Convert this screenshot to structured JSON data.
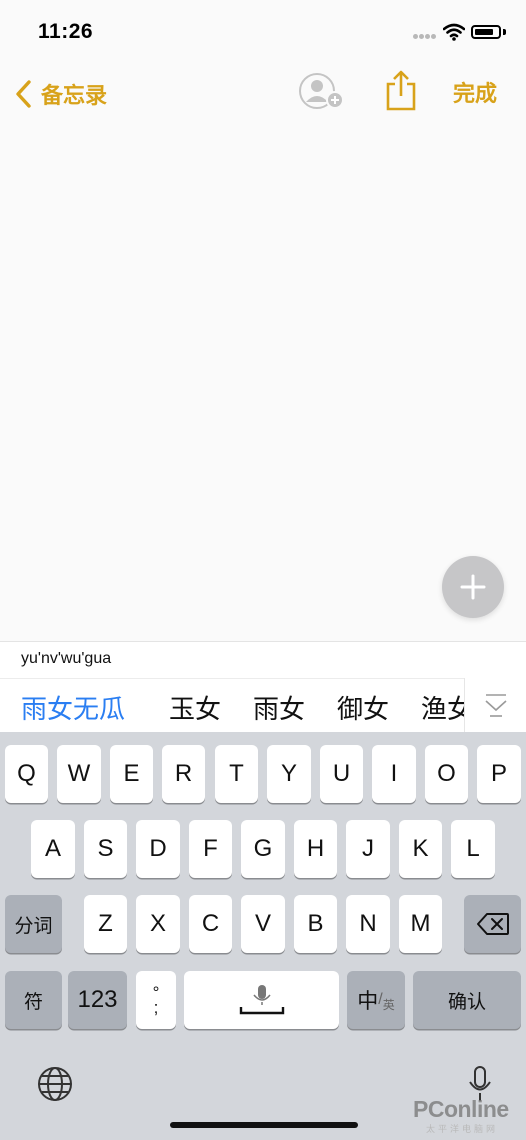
{
  "status_bar": {
    "time": "11:26"
  },
  "nav": {
    "back_label": "备忘录",
    "done_label": "完成"
  },
  "icons": {
    "back": "chevron-left-icon",
    "add_people": "person-add-icon",
    "share": "share-icon",
    "new_item": "plus-icon",
    "expand": "chevron-down-icon",
    "backspace": "backspace-icon",
    "globe": "globe-icon",
    "mic": "microphone-icon"
  },
  "colors": {
    "accent": "#d8a21a",
    "selected_candidate": "#2a7ef2",
    "keyboard_bg": "#d3d6db"
  },
  "ime": {
    "composition": "yu'nv'wu'gua",
    "candidates": [
      "雨女无瓜",
      "玉女",
      "雨女",
      "御女",
      "渔女"
    ]
  },
  "keyboard": {
    "row1": [
      "Q",
      "W",
      "E",
      "R",
      "T",
      "Y",
      "U",
      "I",
      "O",
      "P"
    ],
    "row2": [
      "A",
      "S",
      "D",
      "F",
      "G",
      "H",
      "J",
      "K",
      "L"
    ],
    "row3": [
      "Z",
      "X",
      "C",
      "V",
      "B",
      "N",
      "M"
    ],
    "fenci": "分词",
    "fu": "符",
    "num": "123",
    "punct_top": "°",
    "punct_bottom": ";",
    "zh": "中",
    "en": "英",
    "confirm": "确认"
  },
  "watermark": {
    "brand": "PConline",
    "sub": "太平洋电脑网"
  }
}
